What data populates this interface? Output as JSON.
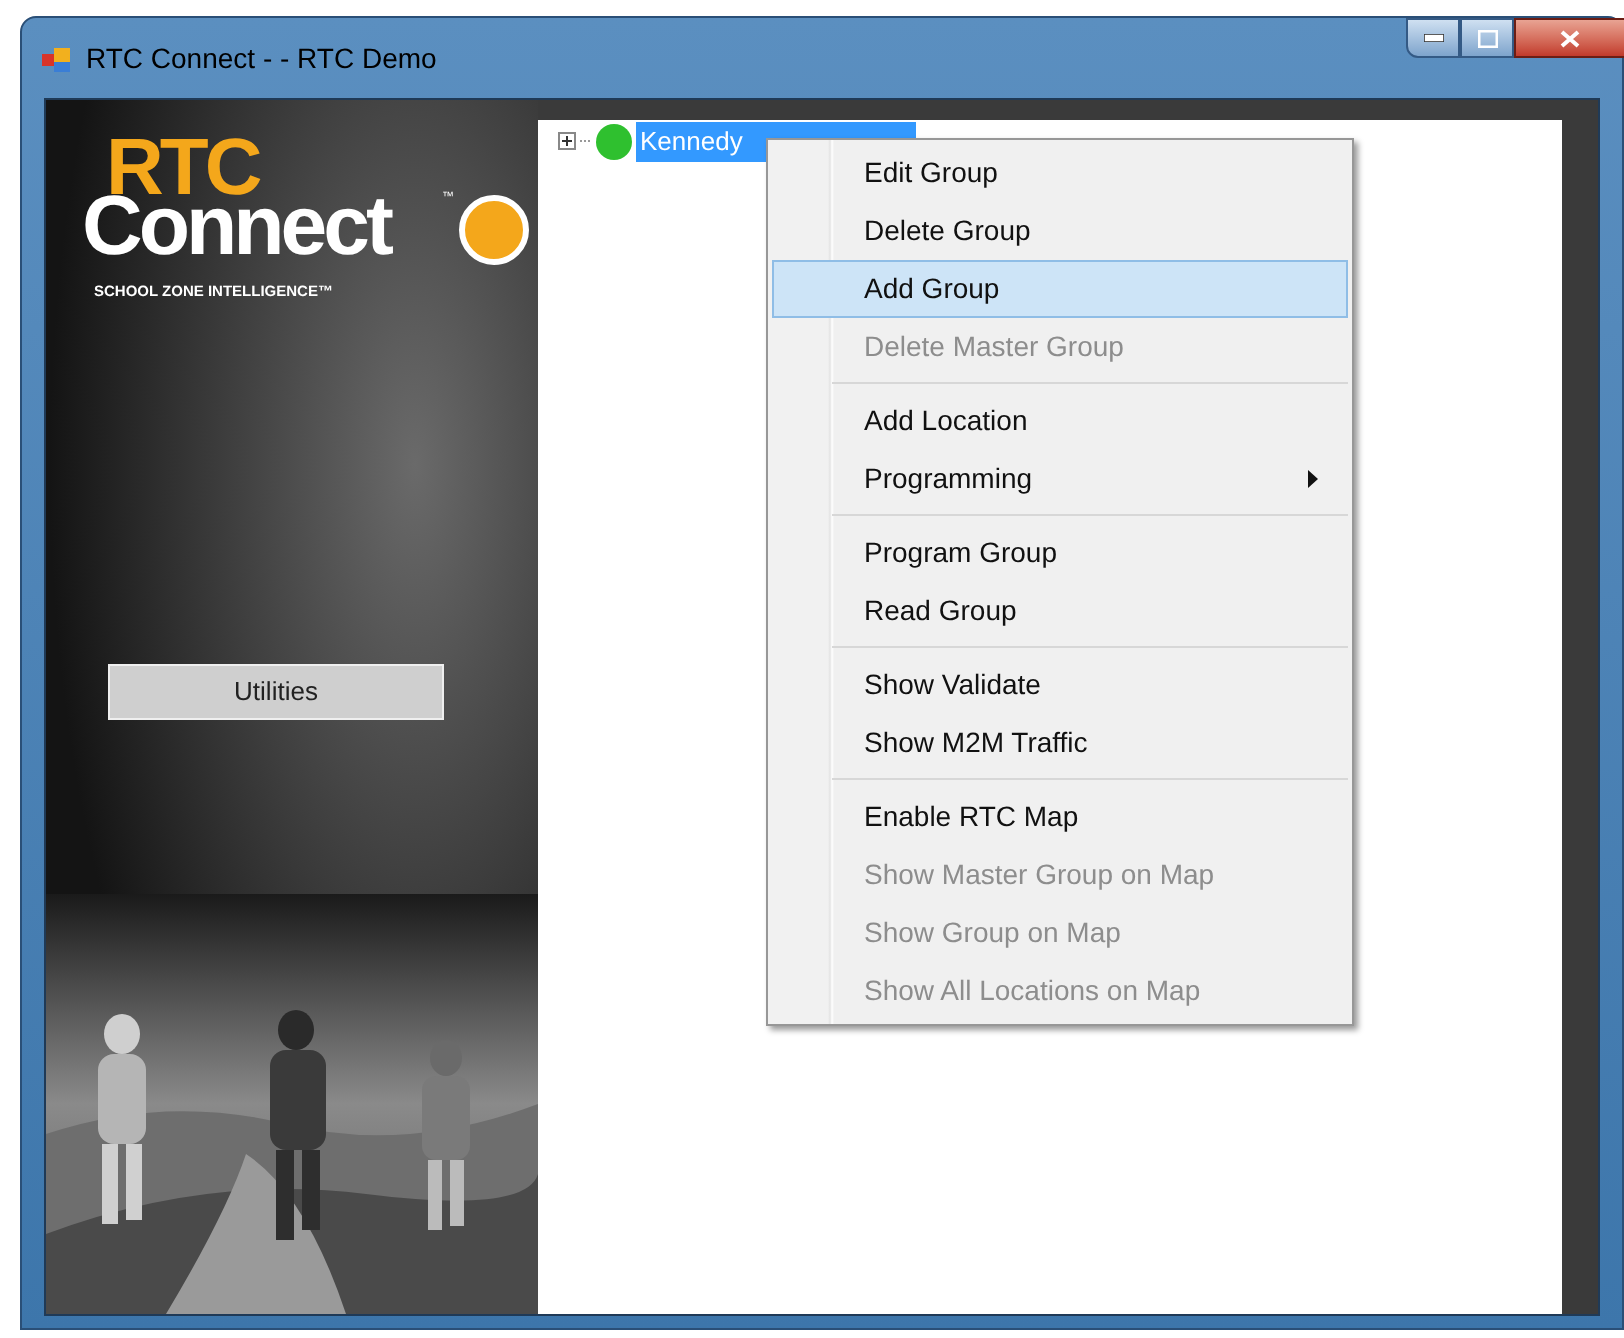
{
  "window": {
    "title": "RTC Connect - -  RTC Demo"
  },
  "logo": {
    "brand_top": "RTC",
    "brand_main": "Connect",
    "trademark": "™",
    "tagline": "SCHOOL ZONE INTELLIGENCE™"
  },
  "sidebar": {
    "button": "Utilities"
  },
  "tree": {
    "items": [
      {
        "label": "Kennedy",
        "expanded": false,
        "selected": true,
        "color": "#2fc02f"
      }
    ]
  },
  "context_menu": {
    "groups": [
      [
        {
          "label": "Edit Group",
          "disabled": false,
          "selected": false,
          "submenu": false
        },
        {
          "label": "Delete Group",
          "disabled": false,
          "selected": false,
          "submenu": false
        },
        {
          "label": "Add Group",
          "disabled": false,
          "selected": true,
          "submenu": false
        },
        {
          "label": "Delete Master Group",
          "disabled": true,
          "selected": false,
          "submenu": false
        }
      ],
      [
        {
          "label": "Add Location",
          "disabled": false,
          "selected": false,
          "submenu": false
        },
        {
          "label": "Programming",
          "disabled": false,
          "selected": false,
          "submenu": true
        }
      ],
      [
        {
          "label": "Program Group",
          "disabled": false,
          "selected": false,
          "submenu": false
        },
        {
          "label": "Read Group",
          "disabled": false,
          "selected": false,
          "submenu": false
        }
      ],
      [
        {
          "label": "Show Validate",
          "disabled": false,
          "selected": false,
          "submenu": false
        },
        {
          "label": "Show M2M Traffic",
          "disabled": false,
          "selected": false,
          "submenu": false
        }
      ],
      [
        {
          "label": "Enable RTC Map",
          "disabled": false,
          "selected": false,
          "submenu": false
        },
        {
          "label": "Show Master Group on Map",
          "disabled": true,
          "selected": false,
          "submenu": false
        },
        {
          "label": "Show Group on Map",
          "disabled": true,
          "selected": false,
          "submenu": false
        },
        {
          "label": "Show All Locations on Map",
          "disabled": true,
          "selected": false,
          "submenu": false
        }
      ]
    ]
  }
}
